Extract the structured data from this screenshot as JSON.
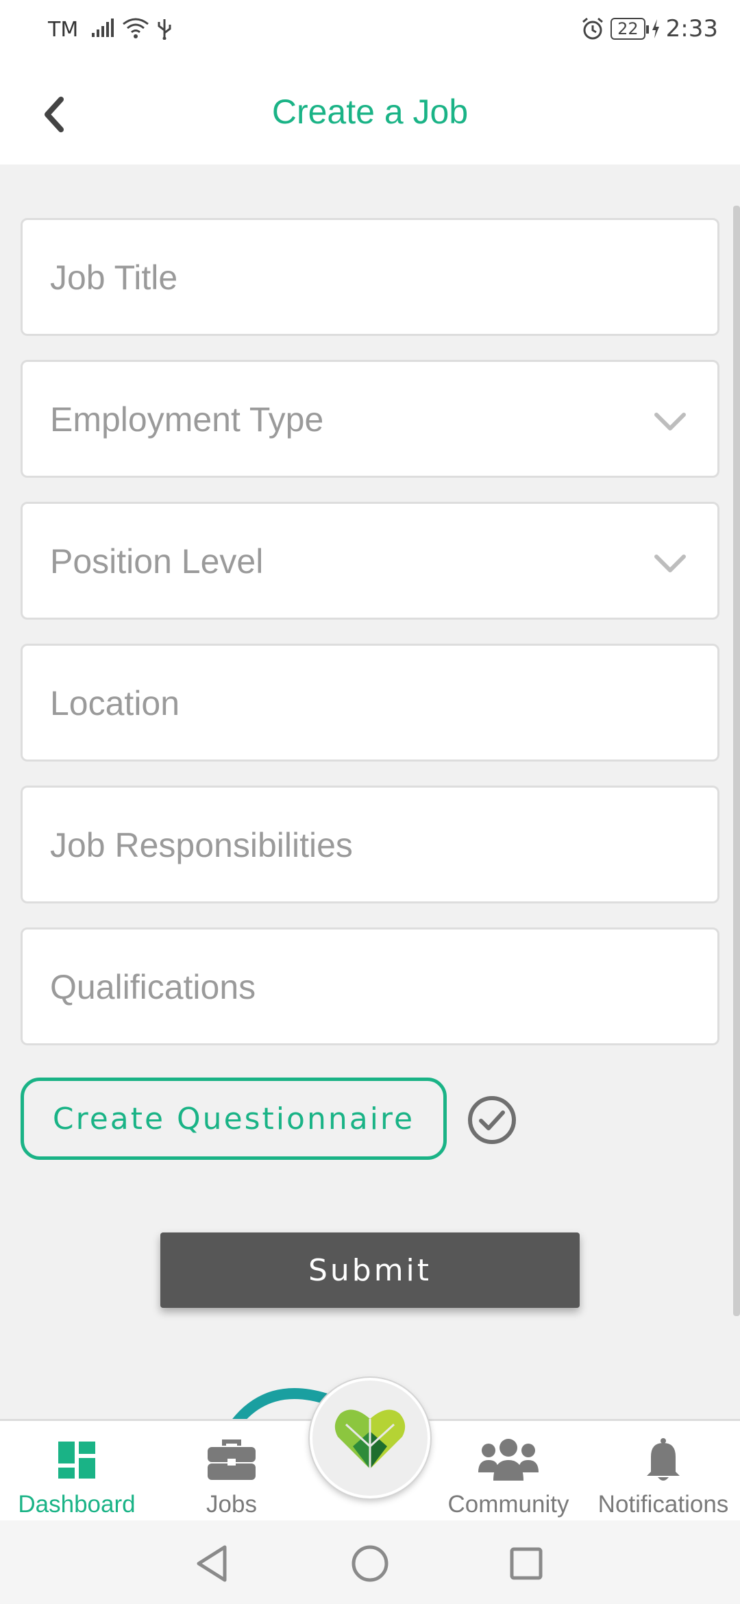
{
  "status_bar": {
    "carrier": "TM",
    "battery": "22",
    "time": "2:33",
    "icons": [
      "signal-icon",
      "wifi-icon",
      "usb-icon",
      "alarm-icon",
      "battery-icon",
      "charging-icon"
    ]
  },
  "header": {
    "title": "Create a Job",
    "back_icon": "chevron-left-icon"
  },
  "form": {
    "job_title": {
      "placeholder": "Job Title",
      "value": ""
    },
    "employment_type": {
      "placeholder": "Employment Type",
      "value": ""
    },
    "position_level": {
      "placeholder": "Position Level",
      "value": ""
    },
    "location": {
      "placeholder": "Location",
      "value": ""
    },
    "job_responsibilities": {
      "placeholder": "Job Responsibilities",
      "value": ""
    },
    "qualifications": {
      "placeholder": "Qualifications",
      "value": ""
    },
    "create_questionnaire_label": "Create Questionnaire",
    "submit_label": "Submit"
  },
  "bottom_nav": {
    "items": [
      {
        "label": "Dashboard",
        "icon": "dashboard-icon",
        "active": true
      },
      {
        "label": "Jobs",
        "icon": "briefcase-icon",
        "active": false
      },
      {
        "label": "Community",
        "icon": "people-icon",
        "active": false
      },
      {
        "label": "Notifications",
        "icon": "bell-icon",
        "active": false
      }
    ],
    "center_icon": "heart-leaf-logo"
  },
  "colors": {
    "accent": "#1ab386",
    "submit_bg": "#575757",
    "nav_inactive": "#7a7a7a",
    "background": "#f1f1f1"
  }
}
